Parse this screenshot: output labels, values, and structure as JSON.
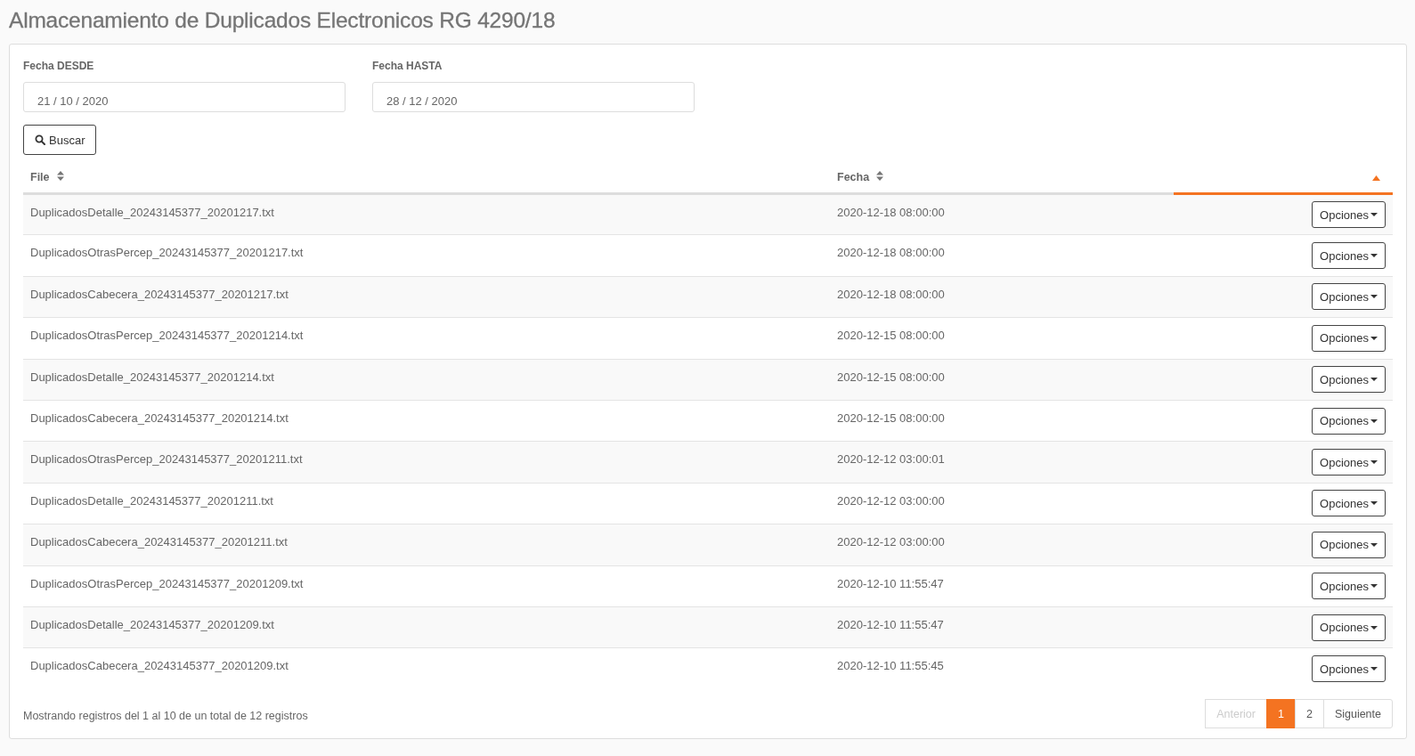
{
  "title": "Almacenamiento de Duplicados Electronicos RG 4290/18",
  "filters": [
    {
      "label": "Fecha DESDE",
      "value": "21 / 10 / 2020"
    },
    {
      "label": "Fecha HASTA",
      "value": "28 / 12 / 2020"
    }
  ],
  "search_button": "Buscar",
  "table": {
    "columns": [
      {
        "label": "File",
        "sorted": false
      },
      {
        "label": "Fecha",
        "sorted": false
      },
      {
        "sorted": true
      }
    ],
    "rows": [
      {
        "file": "DuplicadosDetalle_20243145377_20201217.txt",
        "fecha": "2020-12-18 08:00:00",
        "action": "Opciones"
      },
      {
        "file": "DuplicadosOtrasPercep_20243145377_20201217.txt",
        "fecha": "2020-12-18 08:00:00",
        "action": "Opciones"
      },
      {
        "file": "DuplicadosCabecera_20243145377_20201217.txt",
        "fecha": "2020-12-18 08:00:00",
        "action": "Opciones"
      },
      {
        "file": "DuplicadosOtrasPercep_20243145377_20201214.txt",
        "fecha": "2020-12-15 08:00:00",
        "action": "Opciones"
      },
      {
        "file": "DuplicadosDetalle_20243145377_20201214.txt",
        "fecha": "2020-12-15 08:00:00",
        "action": "Opciones"
      },
      {
        "file": "DuplicadosCabecera_20243145377_20201214.txt",
        "fecha": "2020-12-15 08:00:00",
        "action": "Opciones"
      },
      {
        "file": "DuplicadosOtrasPercep_20243145377_20201211.txt",
        "fecha": "2020-12-12 03:00:01",
        "action": "Opciones"
      },
      {
        "file": "DuplicadosDetalle_20243145377_20201211.txt",
        "fecha": "2020-12-12 03:00:00",
        "action": "Opciones"
      },
      {
        "file": "DuplicadosCabecera_20243145377_20201211.txt",
        "fecha": "2020-12-12 03:00:00",
        "action": "Opciones"
      },
      {
        "file": "DuplicadosOtrasPercep_20243145377_20201209.txt",
        "fecha": "2020-12-10 11:55:47",
        "action": "Opciones"
      },
      {
        "file": "DuplicadosDetalle_20243145377_20201209.txt",
        "fecha": "2020-12-10 11:55:47",
        "action": "Opciones"
      },
      {
        "file": "DuplicadosCabecera_20243145377_20201209.txt",
        "fecha": "2020-12-10 11:55:45",
        "action": "Opciones"
      }
    ]
  },
  "info": "Mostrando registros del 1 al 10 de un total de 12 registros",
  "pagination": [
    {
      "label": "Anterior",
      "disabled": true,
      "selected": false
    },
    {
      "label": "1",
      "disabled": false,
      "selected": true
    },
    {
      "label": "2",
      "disabled": false,
      "selected": false
    },
    {
      "label": "Siguiente",
      "disabled": false,
      "selected": false
    }
  ]
}
